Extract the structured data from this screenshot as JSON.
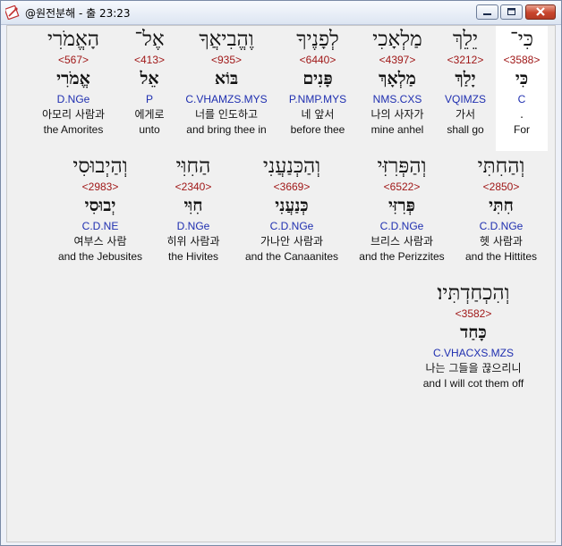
{
  "window": {
    "title": "@원전분해 - 출 23:23"
  },
  "lines": [
    {
      "words": [
        {
          "heb": "כִּי־",
          "num": "<3588>",
          "lemma": "כִּי",
          "parse": "C",
          "kor": ".",
          "eng": "For"
        },
        {
          "heb": "יֵלֵךְ",
          "num": "<3212>",
          "lemma": "יָלַךְ",
          "parse": "VQIMZS",
          "kor": "가서",
          "eng": "shall go"
        },
        {
          "heb": "מַלְאָכִי",
          "num": "<4397>",
          "lemma": "מַלְאָךְ",
          "parse": "NMS.CXS",
          "kor": "나의 사자가",
          "eng": "mine anhel"
        },
        {
          "heb": "לְפָנֶיךָ",
          "num": "<6440>",
          "lemma": "פָּנִים",
          "parse": "P.NMP.MYS",
          "kor": "네 앞서",
          "eng": "before thee"
        },
        {
          "heb": "וֶהֱבִיאֲךָ",
          "num": "<935>",
          "lemma": "בּוֹא",
          "parse": "C.VHAMZS.MYS",
          "kor": "너를 인도하고",
          "eng": "and bring thee in"
        },
        {
          "heb": "אֶל־",
          "num": "<413>",
          "lemma": "אֵל",
          "parse": "P",
          "kor": "에게로",
          "eng": "unto"
        },
        {
          "heb": "הָאֱמֹרִי",
          "num": "<567>",
          "lemma": "אֱמֹרִי",
          "parse": "D.NGe",
          "kor": "아모리 사람과",
          "eng": "the Amorites"
        }
      ]
    },
    {
      "words": [
        {
          "heb": "וְהַחִתִּי",
          "num": "<2850>",
          "lemma": "חִתִּי",
          "parse": "C.D.NGe",
          "kor": "헷 사람과",
          "eng": "and the Hittites"
        },
        {
          "heb": "וְהַפְּרִזִּי",
          "num": "<6522>",
          "lemma": "פְּרִזִּי",
          "parse": "C.D.NGe",
          "kor": "브리스 사람과",
          "eng": "and the Perizzites"
        },
        {
          "heb": "וְהַכְּנַעֲנִי",
          "num": "<3669>",
          "lemma": "כְּנַעֲנִי",
          "parse": "C.D.NGe",
          "kor": "가나안 사람과",
          "eng": "and the Canaanites"
        },
        {
          "heb": "הַחִוִּי",
          "num": "<2340>",
          "lemma": "חִוִּי",
          "parse": "D.NGe",
          "kor": "히위 사람과",
          "eng": "the Hivites"
        },
        {
          "heb": "וְהַיְבוּסִי",
          "num": "<2983>",
          "lemma": "יְבוּסִי",
          "parse": "C.D.NE",
          "kor": "여부스 사람",
          "eng": "and the Jebusites"
        }
      ]
    },
    {
      "words": [
        {
          "heb": "וְהִכְחַדְתִּיו׃",
          "num": "<3582>",
          "lemma": "כָּחַד",
          "parse": "C.VHACXS.MZS",
          "kor": "나는 그들을 끊으리니",
          "eng": "and I will cot them off"
        }
      ]
    }
  ]
}
